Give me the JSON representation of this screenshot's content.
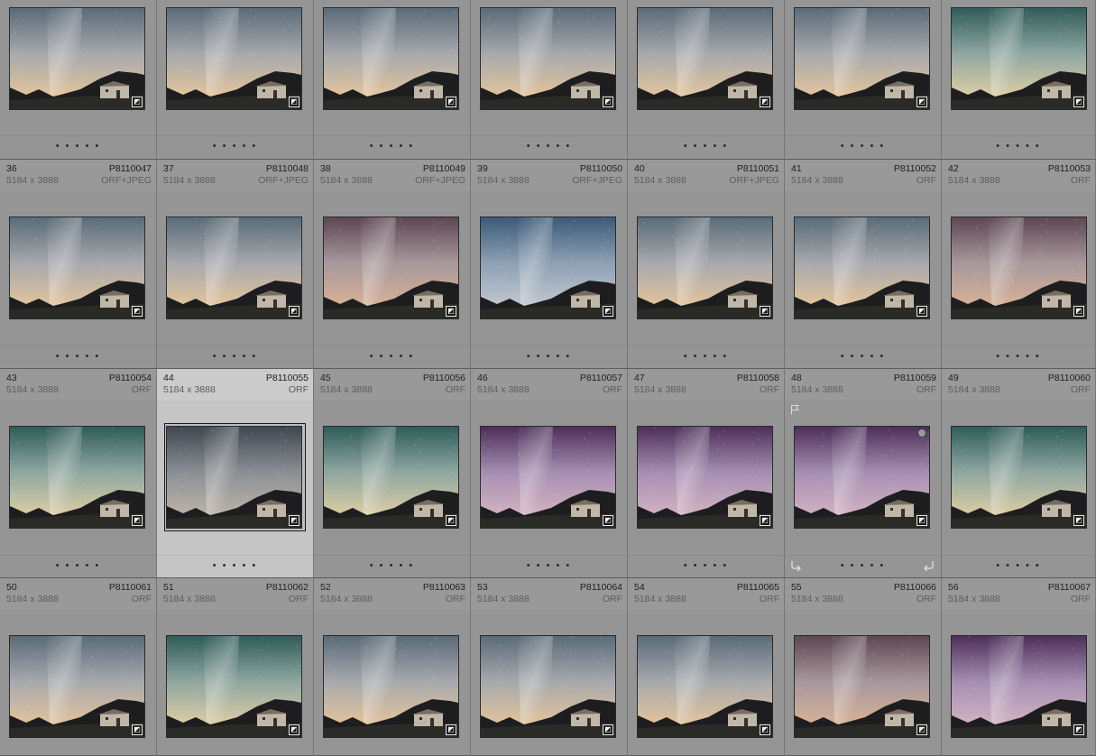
{
  "rows": [
    {
      "type": "partial",
      "cells": [
        {
          "hue": "gold"
        },
        {
          "hue": "gold"
        },
        {
          "hue": "gold"
        },
        {
          "hue": "gold"
        },
        {
          "hue": "gold"
        },
        {
          "hue": "gold"
        },
        {
          "hue": "teal"
        }
      ]
    },
    {
      "type": "full",
      "cells": [
        {
          "index": "36",
          "filename": "P8110047",
          "dims": "5184 x 3888",
          "ftype": "ORF+JPEG",
          "hue": "gold"
        },
        {
          "index": "37",
          "filename": "P8110048",
          "dims": "5184 x 3888",
          "ftype": "ORF+JPEG",
          "hue": "gold"
        },
        {
          "index": "38",
          "filename": "P8110049",
          "dims": "5184 x 3888",
          "ftype": "ORF+JPEG",
          "hue": "rose"
        },
        {
          "index": "39",
          "filename": "P8110050",
          "dims": "5184 x 3888",
          "ftype": "ORF+JPEG",
          "hue": "blue"
        },
        {
          "index": "40",
          "filename": "P8110051",
          "dims": "5184 x 3888",
          "ftype": "ORF+JPEG",
          "hue": "gold"
        },
        {
          "index": "41",
          "filename": "P8110052",
          "dims": "5184 x 3888",
          "ftype": "ORF",
          "hue": "gold"
        },
        {
          "index": "42",
          "filename": "P8110053",
          "dims": "5184 x 3888",
          "ftype": "ORF",
          "hue": "rose"
        }
      ]
    },
    {
      "type": "full",
      "cells": [
        {
          "index": "43",
          "filename": "P8110054",
          "dims": "5184 x 3888",
          "ftype": "ORF",
          "hue": "teal"
        },
        {
          "index": "44",
          "filename": "P8110055",
          "dims": "5184 x 3888",
          "ftype": "ORF",
          "hue": "gray",
          "selected": true
        },
        {
          "index": "45",
          "filename": "P8110056",
          "dims": "5184 x 3888",
          "ftype": "ORF",
          "hue": "teal"
        },
        {
          "index": "46",
          "filename": "P8110057",
          "dims": "5184 x 3888",
          "ftype": "ORF",
          "hue": "purple"
        },
        {
          "index": "47",
          "filename": "P8110058",
          "dims": "5184 x 3888",
          "ftype": "ORF",
          "hue": "purple"
        },
        {
          "index": "48",
          "filename": "P8110059",
          "dims": "5184 x 3888",
          "ftype": "ORF",
          "hue": "purple",
          "hovered": true
        },
        {
          "index": "49",
          "filename": "P8110060",
          "dims": "5184 x 3888",
          "ftype": "ORF",
          "hue": "teal"
        }
      ]
    },
    {
      "type": "bottom",
      "cells": [
        {
          "index": "50",
          "filename": "P8110061",
          "dims": "5184 x 3888",
          "ftype": "ORF",
          "hue": "gold"
        },
        {
          "index": "51",
          "filename": "P8110062",
          "dims": "5184 x 3888",
          "ftype": "ORF",
          "hue": "teal"
        },
        {
          "index": "52",
          "filename": "P8110063",
          "dims": "5184 x 3888",
          "ftype": "ORF",
          "hue": "gold"
        },
        {
          "index": "53",
          "filename": "P8110064",
          "dims": "5184 x 3888",
          "ftype": "ORF",
          "hue": "gold"
        },
        {
          "index": "54",
          "filename": "P8110065",
          "dims": "5184 x 3888",
          "ftype": "ORF",
          "hue": "gold"
        },
        {
          "index": "55",
          "filename": "P8110066",
          "dims": "5184 x 3888",
          "ftype": "ORF",
          "hue": "rose"
        },
        {
          "index": "56",
          "filename": "P8110067",
          "dims": "5184 x 3888",
          "ftype": "ORF",
          "hue": "purple"
        }
      ]
    }
  ],
  "rating_dots": "• • • • •",
  "edit_badge_icon": "develop-adjustment-icon",
  "colors": {
    "cell_bg": "#959595",
    "selected_bg": "#c5c5c5",
    "grid_bg": "#8c8c8c"
  },
  "palettes": {
    "gold": {
      "sky_top": "#5a6b78",
      "sky_mid": "#a7a8ad",
      "horizon": "#e8c79a"
    },
    "teal": {
      "sky_top": "#2f5c5a",
      "sky_mid": "#8fa6a0",
      "horizon": "#e4d2a5"
    },
    "rose": {
      "sky_top": "#5d4753",
      "sky_mid": "#a7979b",
      "horizon": "#dcb497"
    },
    "blue": {
      "sky_top": "#3b5a78",
      "sky_mid": "#8da0b3",
      "horizon": "#c7ccd2"
    },
    "purple": {
      "sky_top": "#4c2f5a",
      "sky_mid": "#a58fb1",
      "horizon": "#d8b6c4"
    },
    "gray": {
      "sky_top": "#3f4750",
      "sky_mid": "#8b8f93",
      "horizon": "#c2b7aa"
    }
  }
}
